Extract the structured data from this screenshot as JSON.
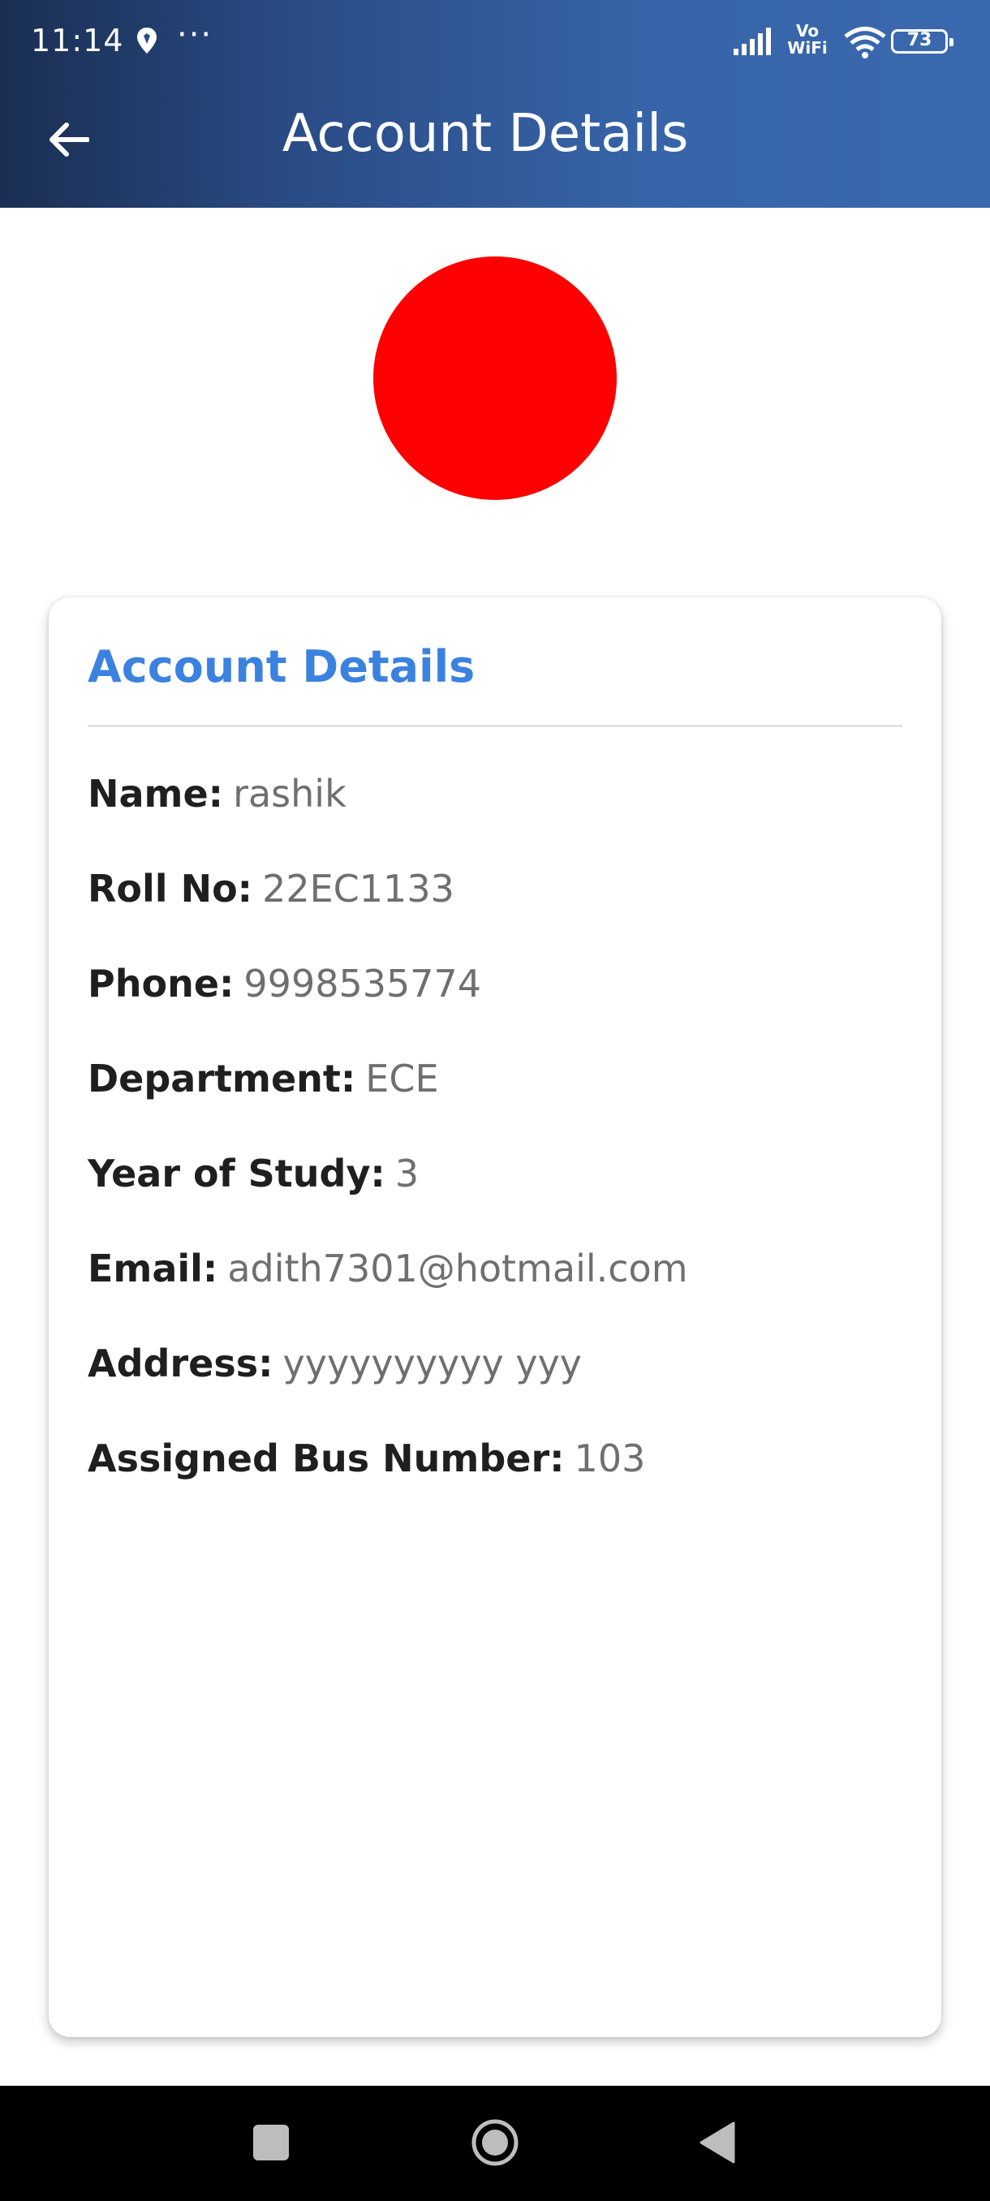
{
  "status_bar": {
    "time": "11:14",
    "overflow_dots": "···",
    "vowifi_line1": "Vo",
    "vowifi_line2": "WiFi",
    "battery_level": "73"
  },
  "header": {
    "title": "Account Details",
    "back_icon": "arrow-left-icon",
    "gradient_colors": [
      "#1a2e52",
      "#3b69ae"
    ]
  },
  "avatar": {
    "color": "#ff0000"
  },
  "card": {
    "title": "Account Details",
    "title_color": "#3b82e0",
    "fields": [
      {
        "label": "Name:",
        "value": "rashik"
      },
      {
        "label": "Roll No:",
        "value": "22EC1133"
      },
      {
        "label": "Phone:",
        "value": "9998535774"
      },
      {
        "label": "Department:",
        "value": "ECE"
      },
      {
        "label": "Year of Study:",
        "value": "3"
      },
      {
        "label": "Email:",
        "value": "adith7301@hotmail.com"
      },
      {
        "label": "Address:",
        "value": "yyyyyyyyyy yyy"
      },
      {
        "label": "Assigned Bus Number:",
        "value": "103"
      }
    ]
  },
  "nav_bar": {
    "recents_icon": "square-icon",
    "home_icon": "circle-home-icon",
    "back_icon": "triangle-back-icon"
  }
}
